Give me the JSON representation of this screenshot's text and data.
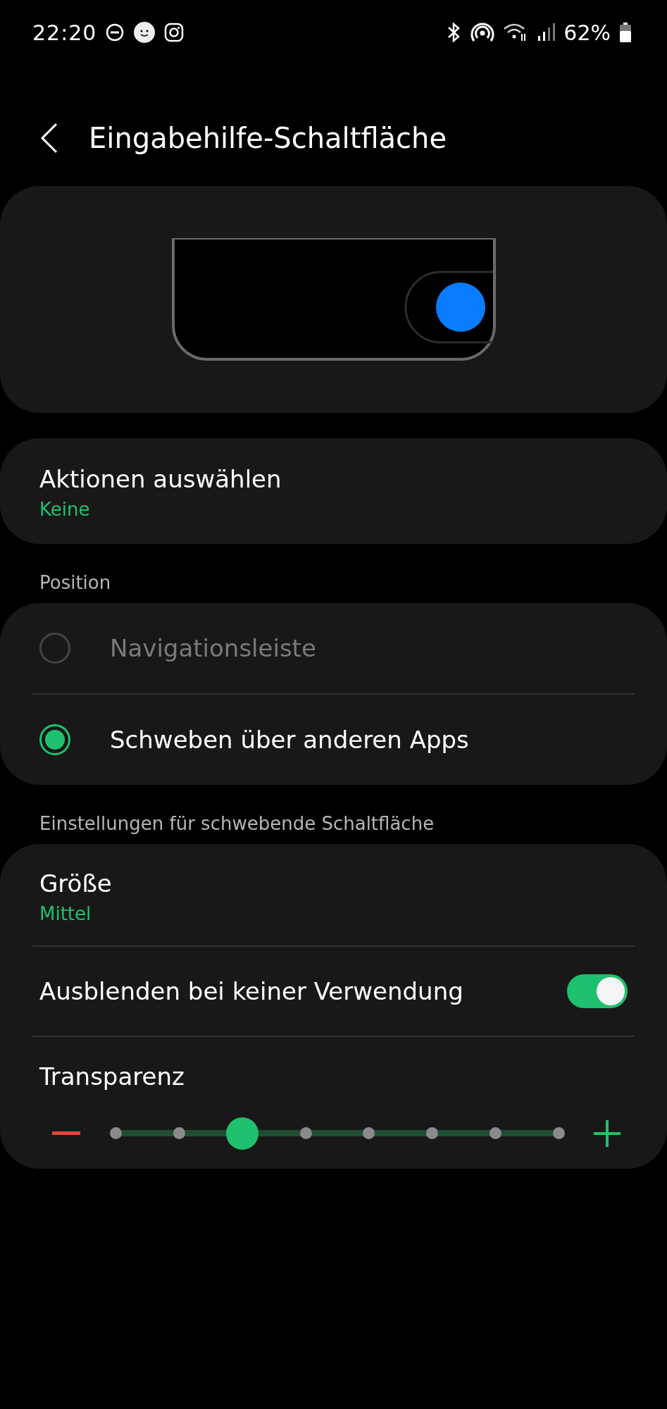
{
  "status_bar": {
    "time": "22:20",
    "battery": "62%"
  },
  "header": {
    "title": "Eingabehilfe-Schaltfläche"
  },
  "actions": {
    "title": "Aktionen auswählen",
    "value": "Keine"
  },
  "position": {
    "label": "Position",
    "options": [
      {
        "label": "Navigationsleiste",
        "selected": false,
        "disabled": true
      },
      {
        "label": "Schweben über anderen Apps",
        "selected": true,
        "disabled": false
      }
    ]
  },
  "floating": {
    "label": "Einstellungen für schwebende Schaltfläche",
    "rows": [
      {
        "kind": "value",
        "title": "Größe",
        "value": "Mittel"
      },
      {
        "kind": "toggle",
        "title": "Ausblenden bei keiner Verwendung",
        "on": true
      },
      {
        "kind": "slider",
        "title": "Transparenz",
        "level": 0.2857
      }
    ]
  }
}
